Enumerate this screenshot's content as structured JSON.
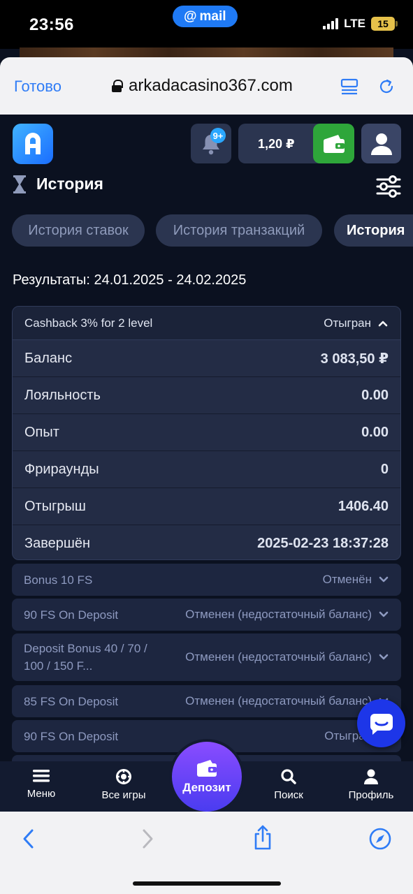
{
  "status_bar": {
    "time": "23:56",
    "mail_pill": "mail",
    "network": "LTE",
    "battery": "15"
  },
  "browser": {
    "done_label": "Готово",
    "url": "arkadacasino367.com"
  },
  "header": {
    "notifications_badge": "9+",
    "balance": "1,20 ₽"
  },
  "section": {
    "title": "История"
  },
  "tabs": [
    {
      "label": "История ставок",
      "active": false
    },
    {
      "label": "История транзакций",
      "active": false
    },
    {
      "label": "История",
      "active": true
    }
  ],
  "results_label": "Результаты: 24.01.2025 - 24.02.2025",
  "expanded_bonus": {
    "name": "Cashback 3% for 2 level",
    "status": "Отыгран",
    "rows": [
      {
        "label": "Баланс",
        "value": "3 083,50 ₽"
      },
      {
        "label": "Лояльность",
        "value": "0.00"
      },
      {
        "label": "Опыт",
        "value": "0.00"
      },
      {
        "label": "Фрираунды",
        "value": "0"
      },
      {
        "label": "Отыгрыш",
        "value": "1406.40"
      },
      {
        "label": "Завершён",
        "value": "2025-02-23 18:37:28"
      }
    ]
  },
  "bonus_list": [
    {
      "name": "Bonus 10 FS",
      "status": "Отменён"
    },
    {
      "name": "90 FS On Deposit",
      "status": "Отменен (недостаточный баланс)"
    },
    {
      "name": "Deposit Bonus 40 / 70 / 100 / 150 F...",
      "status": "Отменен (недостаточный баланс)"
    },
    {
      "name": "85 FS On Deposit",
      "status": "Отменен (недостаточный баланс)"
    },
    {
      "name": "90 FS On Deposit",
      "status": "Отыгран"
    }
  ],
  "bottom_nav": {
    "menu": "Меню",
    "all_games": "Все игры",
    "deposit": "Депозит",
    "search": "Поиск",
    "profile": "Профиль"
  },
  "colors": {
    "accent_blue": "#2f7cf6",
    "wallet_green": "#2ea63a",
    "deposit_purple": "#6a46f8",
    "bg": "#0b1120"
  }
}
